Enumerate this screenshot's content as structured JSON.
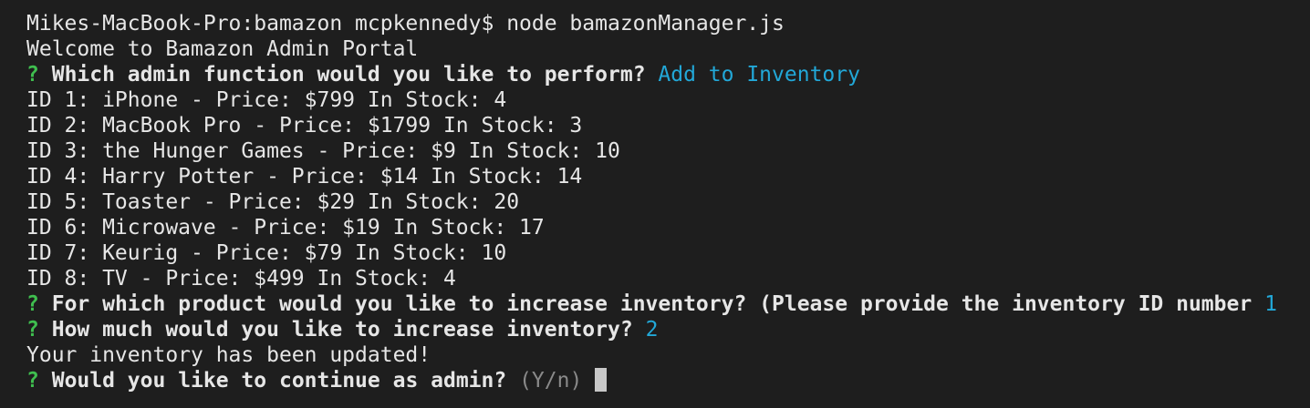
{
  "terminal": {
    "command_line": "Mikes-MacBook-Pro:bamazon mcpkennedy$ node bamazonManager.js",
    "welcome": "Welcome to Bamazon Admin Portal",
    "prompt_marker": "?",
    "q1": {
      "question": "Which admin function would you like to perform?",
      "answer": "Add to Inventory"
    },
    "products": [
      "ID 1: iPhone - Price: $799 In Stock: 4",
      "ID 2: MacBook Pro - Price: $1799 In Stock: 3",
      "ID 3: the Hunger Games - Price: $9 In Stock: 10",
      "ID 4: Harry Potter - Price: $14 In Stock: 14",
      "ID 5: Toaster - Price: $29 In Stock: 20",
      "ID 6: Microwave - Price: $19 In Stock: 17",
      "ID 7: Keurig - Price: $79 In Stock: 10",
      "ID 8: TV - Price: $499 In Stock: 4"
    ],
    "q2": {
      "question": "For which product would you like to increase inventory? (Please provide the inventory ID number",
      "answer": "1"
    },
    "q3": {
      "question": "How much would you like to increase inventory?",
      "answer": "2"
    },
    "updated_message": "Your inventory has been updated!",
    "q4": {
      "question": "Would you like to continue as admin?",
      "hint": "(Y/n)"
    },
    "colors": {
      "background": "#1e1e1e",
      "text": "#e6e6e6",
      "prompt_marker": "#3fbf4f",
      "answer": "#22a8d8",
      "hint": "#8a8a8a"
    }
  }
}
